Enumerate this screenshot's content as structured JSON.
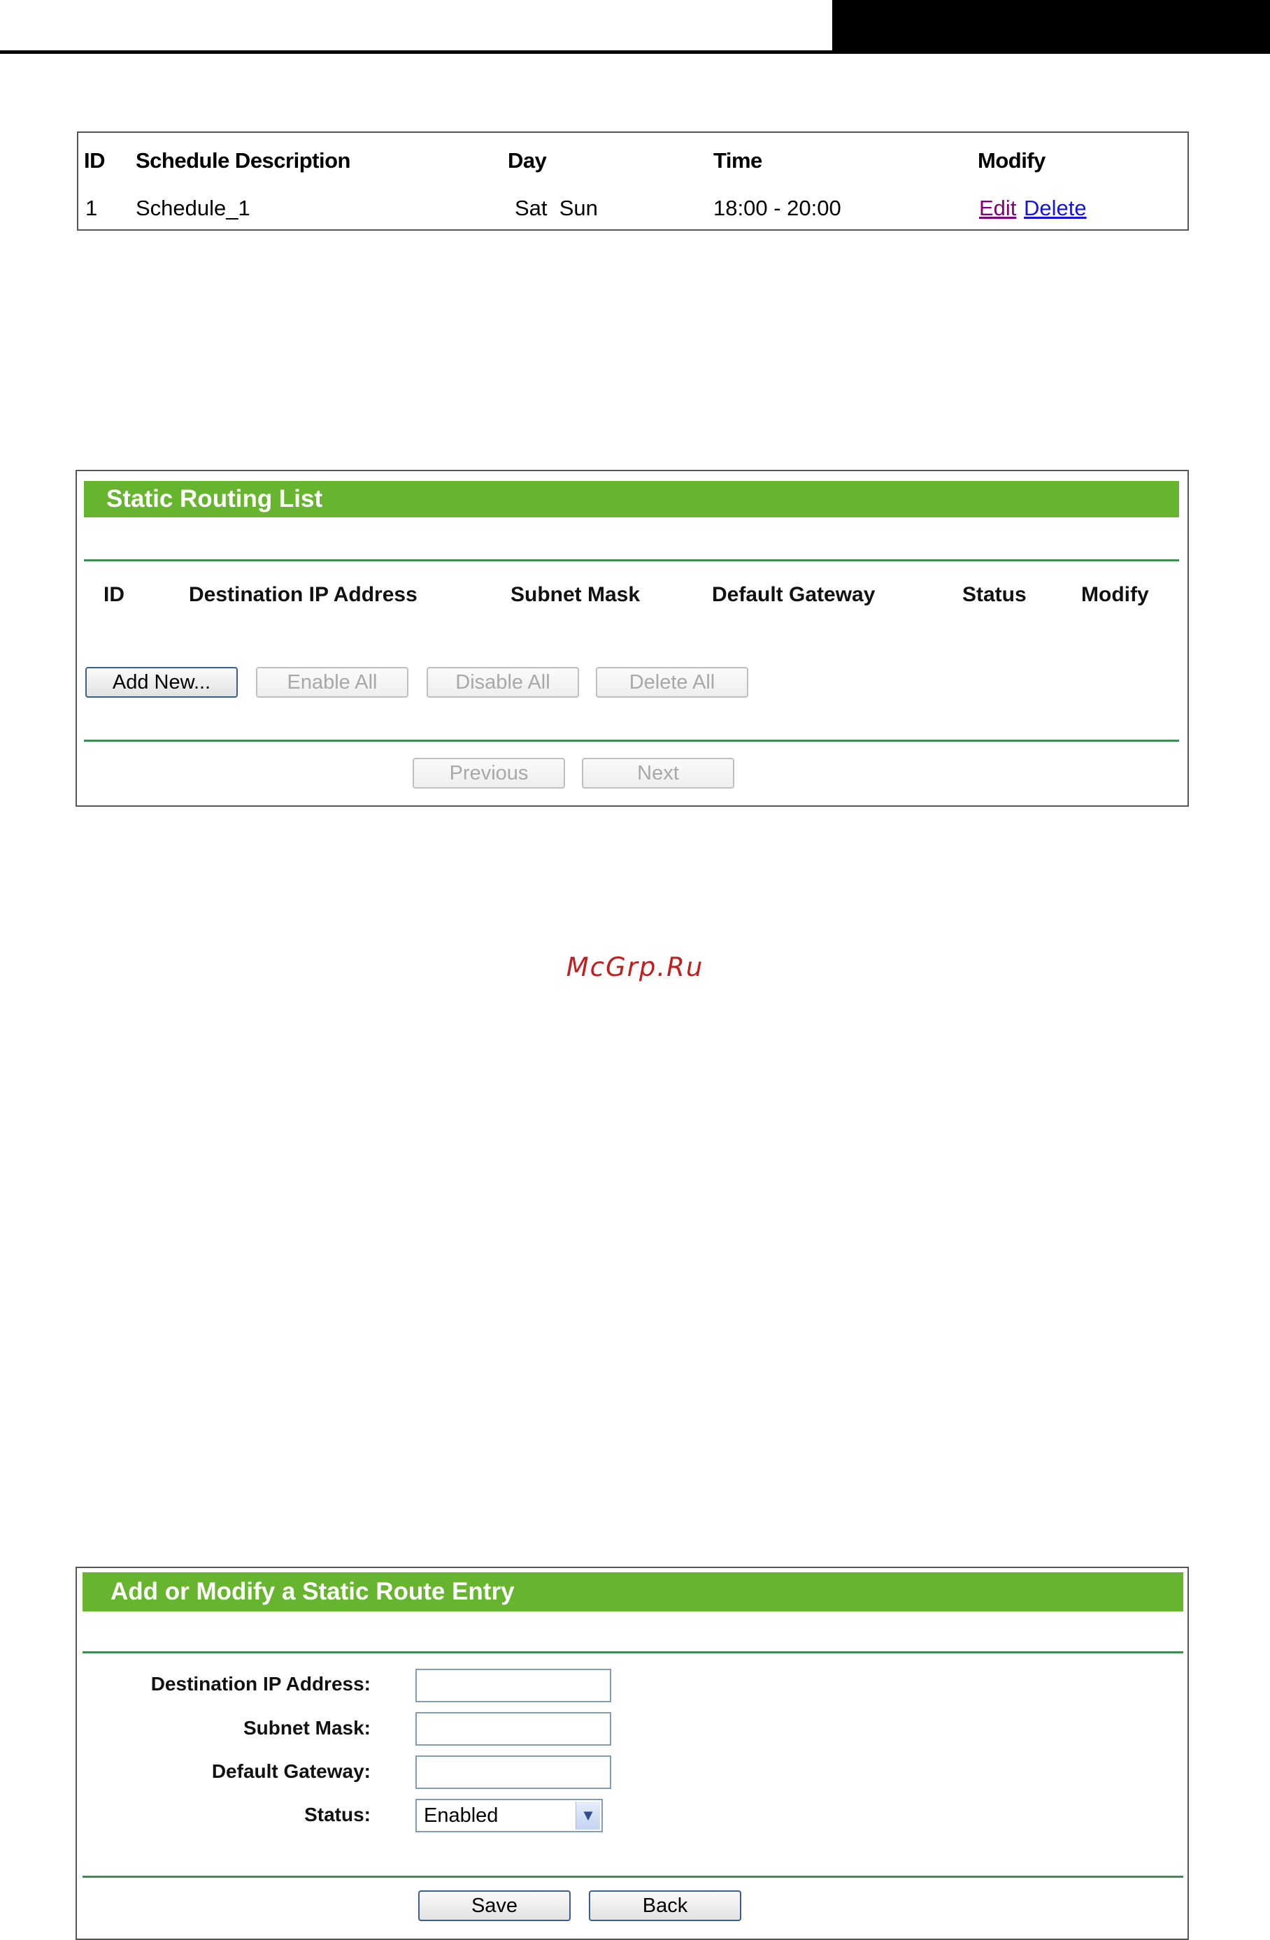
{
  "schedule_table": {
    "headers": [
      "ID",
      "Schedule Description",
      "Day",
      "Time",
      "Modify"
    ],
    "rows": [
      {
        "id": "1",
        "description": "Schedule_1",
        "day": "Sat  Sun",
        "time": "18:00 - 20:00",
        "edit": "Edit",
        "delete": "Delete"
      }
    ]
  },
  "static_routing_list": {
    "title": "Static Routing List",
    "headers": [
      "ID",
      "Destination IP Address",
      "Subnet Mask",
      "Default Gateway",
      "Status",
      "Modify"
    ],
    "buttons": {
      "add_new": "Add New...",
      "enable_all": "Enable All",
      "disable_all": "Disable All",
      "delete_all": "Delete All"
    },
    "pager": {
      "previous": "Previous",
      "next": "Next"
    }
  },
  "watermark": "McGrp.Ru",
  "add_modify_form": {
    "title": "Add or Modify a Static Route Entry",
    "fields": {
      "destination_label": "Destination IP Address:",
      "destination_value": "",
      "subnet_label": "Subnet Mask:",
      "subnet_value": "",
      "gateway_label": "Default Gateway:",
      "gateway_value": "",
      "status_label": "Status:",
      "status_value": "Enabled"
    },
    "buttons": {
      "save": "Save",
      "back": "Back"
    }
  },
  "colors": {
    "header_green": "#67b52f",
    "divider_green": "#3d8c50",
    "visited_link": "#800080",
    "link": "#1414dc",
    "watermark": "#c11e1e"
  },
  "icons": {
    "select_arrow": "chevron-down-icon"
  }
}
